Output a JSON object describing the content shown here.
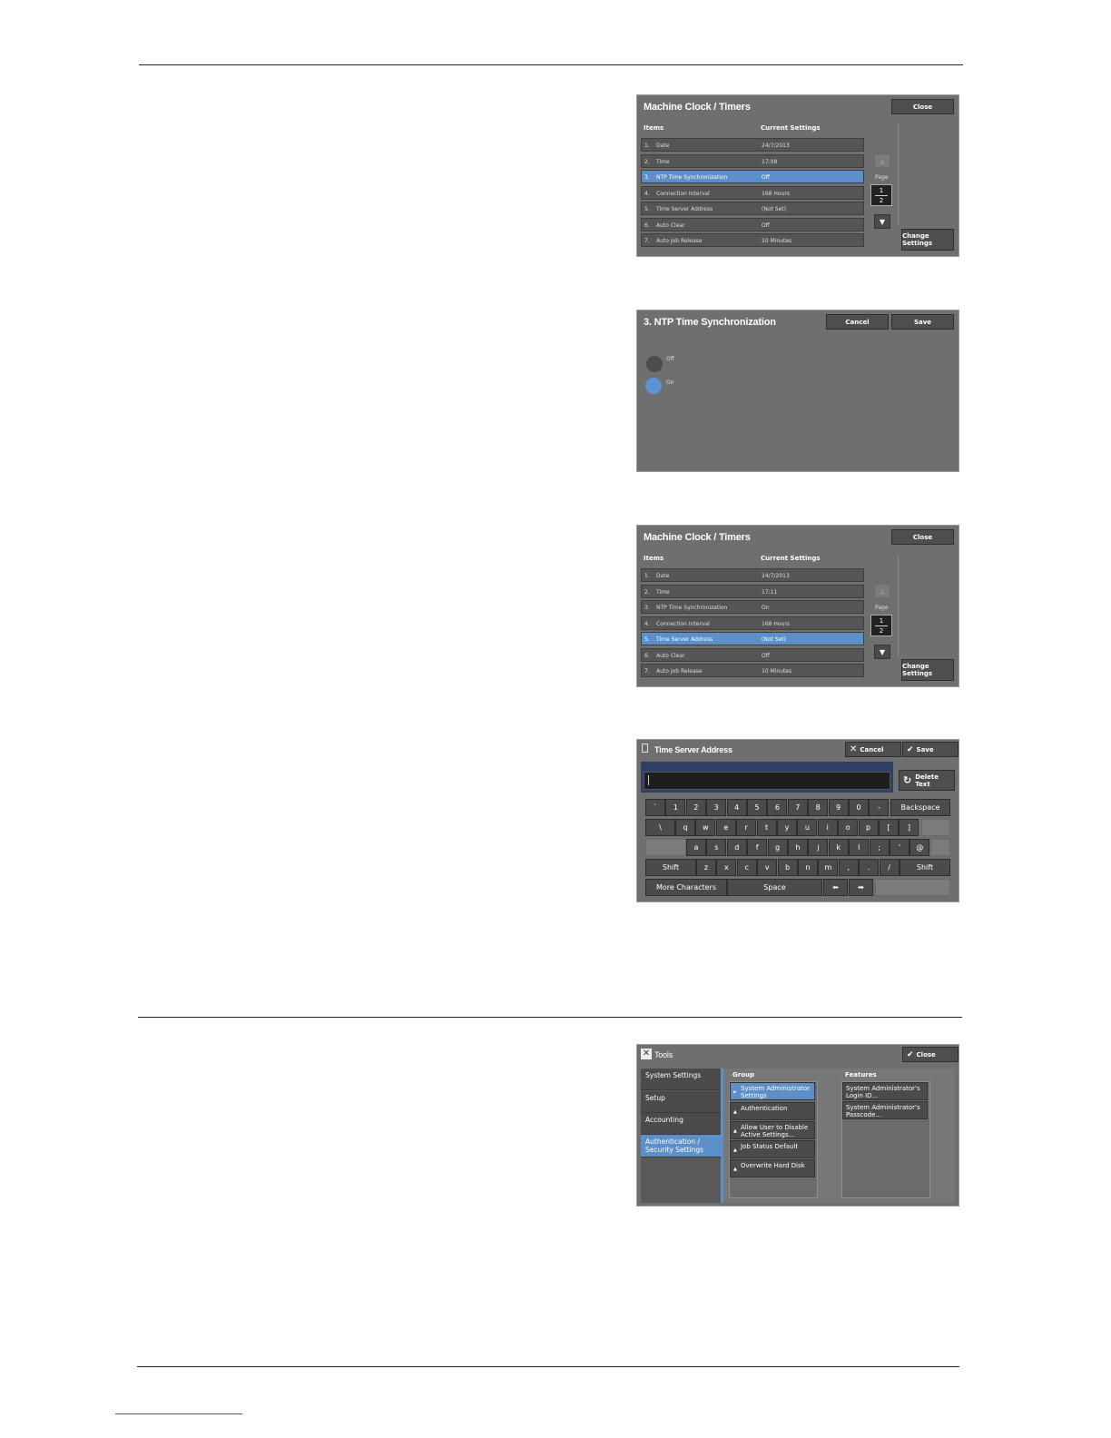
{
  "clock1": {
    "title": "Machine Clock / Timers",
    "close": "Close",
    "col_item": "Items",
    "col_setting": "Current Settings",
    "rows": [
      {
        "num": "1.",
        "name": "Date",
        "value": "24/7/2013"
      },
      {
        "num": "2.",
        "name": "Time",
        "value": "17:08"
      },
      {
        "num": "3.",
        "name": "NTP Time Synchronization",
        "value": "Off"
      },
      {
        "num": "4.",
        "name": "Connection Interval",
        "value": "168 Hours"
      },
      {
        "num": "5.",
        "name": "Time Server Address",
        "value": "(Not Set)"
      },
      {
        "num": "6.",
        "name": "Auto Clear",
        "value": "Off"
      },
      {
        "num": "7.",
        "name": "Auto Job Release",
        "value": "10 Minutes"
      }
    ],
    "selected_index": 2,
    "page_label": "Page",
    "page_current": "1",
    "page_total": "2",
    "up": "▲",
    "down": "▼",
    "change": "Change Settings"
  },
  "ntp": {
    "title": "3. NTP Time Synchronization",
    "cancel": "Cancel",
    "save": "Save",
    "options": [
      "Off",
      "On"
    ],
    "selected": "On"
  },
  "clock2": {
    "title": "Machine Clock / Timers",
    "close": "Close",
    "col_item": "Items",
    "col_setting": "Current Settings",
    "rows": [
      {
        "num": "1.",
        "name": "Date",
        "value": "24/7/2013"
      },
      {
        "num": "2.",
        "name": "Time",
        "value": "17:11"
      },
      {
        "num": "3.",
        "name": "NTP Time Synchronization",
        "value": "On"
      },
      {
        "num": "4.",
        "name": "Connection Interval",
        "value": "168 Hours"
      },
      {
        "num": "5.",
        "name": "Time Server Address",
        "value": "(Not Set)"
      },
      {
        "num": "6.",
        "name": "Auto Clear",
        "value": "Off"
      },
      {
        "num": "7.",
        "name": "Auto Job Release",
        "value": "10 Minutes"
      }
    ],
    "selected_index": 4,
    "page_label": "Page",
    "page_current": "1",
    "page_total": "2",
    "up": "▲",
    "down": "▼",
    "change": "Change Settings"
  },
  "keyboard": {
    "title": "Time Server Address",
    "cancel": "Cancel",
    "save": "Save",
    "delete_text": "Delete Text",
    "input_value": "",
    "row1": [
      "`",
      "1",
      "2",
      "3",
      "4",
      "5",
      "6",
      "7",
      "8",
      "9",
      "0",
      "-"
    ],
    "backspace": "Backspace",
    "row2": [
      "\\",
      "q",
      "w",
      "e",
      "r",
      "t",
      "y",
      "u",
      "i",
      "o",
      "p",
      "[",
      "]"
    ],
    "row3": [
      "a",
      "s",
      "d",
      "f",
      "g",
      "h",
      "j",
      "k",
      "l",
      ";",
      "'",
      "@"
    ],
    "shift": "Shift",
    "row4": [
      "z",
      "x",
      "c",
      "v",
      "b",
      "n",
      "m",
      ",",
      ".",
      "/"
    ],
    "more_chars": "More Characters",
    "space": "Space",
    "left_arrow": "⬅",
    "right_arrow": "➡"
  },
  "tools": {
    "title": "Tools",
    "close": "Close",
    "nav": [
      "System Settings",
      "Setup",
      "Accounting",
      "Authentication / Security Settings"
    ],
    "nav_selected": 3,
    "group_label": "Group",
    "groups": [
      "System Administrator Settings",
      "Authentication",
      "Allow User to Disable Active Settings...",
      "Job Status Default",
      "Overwrite Hard Disk"
    ],
    "group_selected": 0,
    "features_label": "Features",
    "features": [
      "System Administrator's Login ID...",
      "System Administrator's Passcode..."
    ]
  },
  "colors": {
    "panel_bg": "#6f6f6f",
    "selection_blue": "#5d8fc8",
    "button_dark": "#4b4b4b"
  }
}
